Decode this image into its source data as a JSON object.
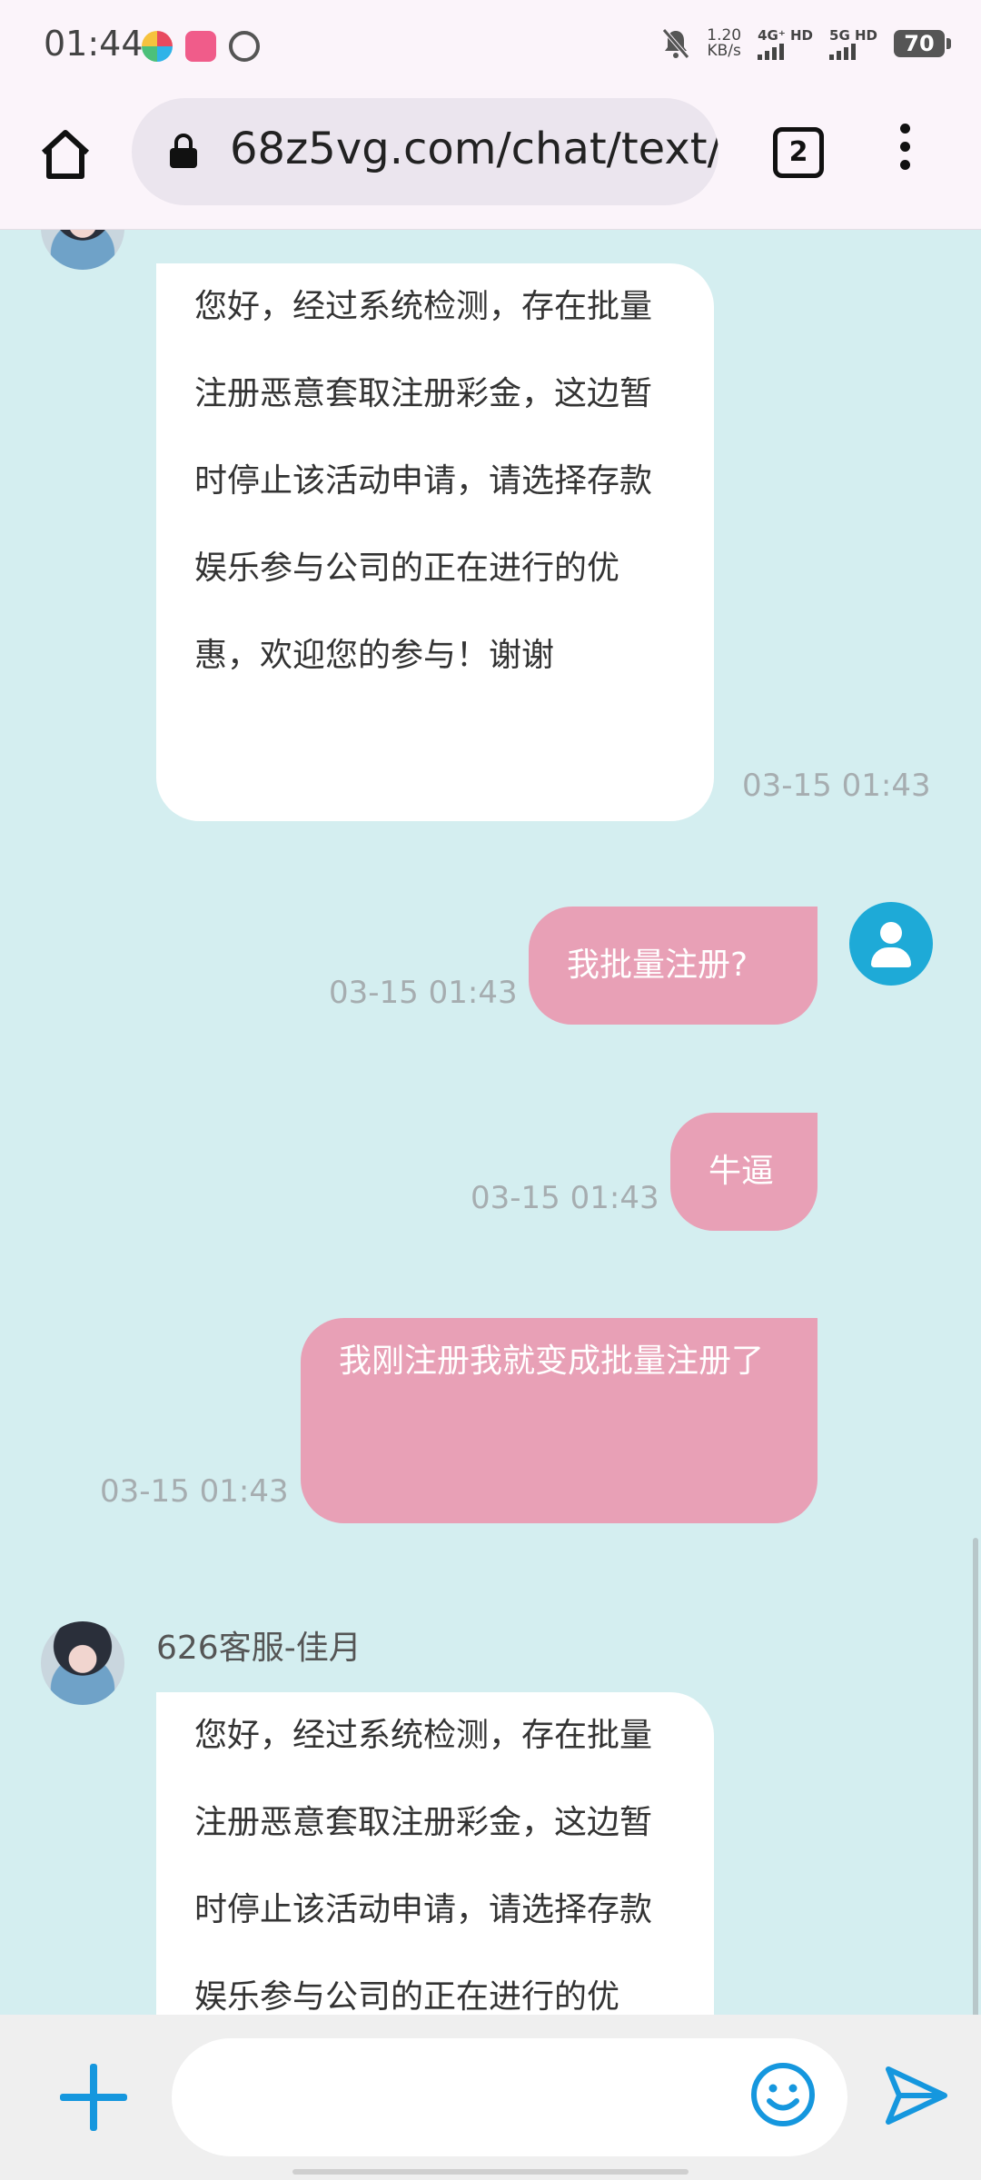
{
  "status_bar": {
    "time": "01:44",
    "net_speed_value": "1.20",
    "net_speed_unit": "KB/s",
    "signal1": "4G⁺ HD",
    "signal2": "5G HD",
    "battery": "70"
  },
  "browser": {
    "url": "68z5vg.com/chat/text/",
    "tab_count": "2"
  },
  "chat": {
    "agent_name": "626客服-佳月",
    "messages": [
      {
        "from": "agent",
        "text": "您好，经过系统检测，存在批量注册恶意套取注册彩金，这边暂时停止该活动申请，请选择存款娱乐参与公司的正在进行的优惠，欢迎您的参与！谢谢",
        "time": "03-15 01:43"
      },
      {
        "from": "me",
        "text": "我批量注册?",
        "time": "03-15 01:43"
      },
      {
        "from": "me",
        "text": "牛逼",
        "time": "03-15 01:43"
      },
      {
        "from": "me",
        "text": "我刚注册我就变成批量注册了",
        "time": "03-15 01:43"
      },
      {
        "from": "agent",
        "text": "您好，经过系统检测，存在批量注册恶意套取注册彩金，这边暂时停止该活动申请，请选择存款娱乐参与公司的正在进行的优惠，欢迎您的参与！谢谢",
        "time": ""
      }
    ]
  },
  "input": {
    "placeholder": ""
  },
  "colors": {
    "chat_bg": "#d4eef0",
    "my_bubble": "#e8a0b6",
    "agent_bubble": "#ffffff",
    "accent": "#1597de"
  },
  "icons": [
    "home-icon",
    "lock-icon",
    "tabs-icon",
    "more-vert-icon",
    "user-icon",
    "plus-icon",
    "emoji-icon",
    "send-icon"
  ]
}
